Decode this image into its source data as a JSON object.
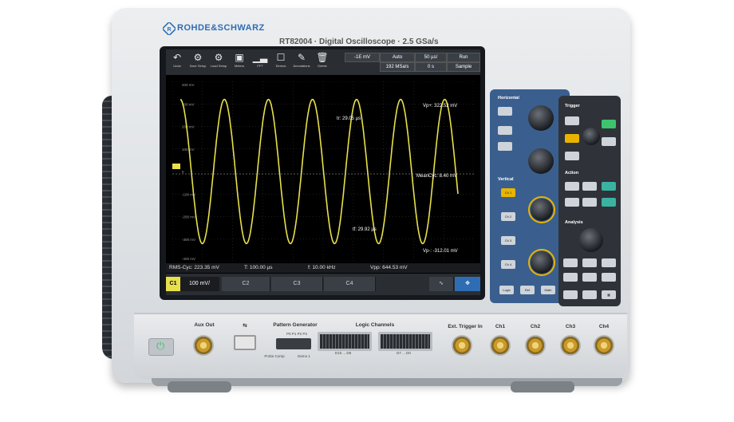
{
  "device": {
    "brand": "ROHDE&SCHWARZ",
    "model_line": "RT82004 · Digital Oscilloscope · 2.5 GSa/s",
    "accent_color": "#2e6db4",
    "trace_color": "#e8e04a"
  },
  "toolbar": {
    "items": [
      {
        "label": "Undo",
        "icon": "undo-icon"
      },
      {
        "label": "Save Setup",
        "icon": "save-icon"
      },
      {
        "label": "Load Setup",
        "icon": "load-icon"
      },
      {
        "label": "Meters",
        "icon": "meter-icon"
      },
      {
        "label": "FFT",
        "icon": "fft-icon"
      },
      {
        "label": "Demos",
        "icon": "demo-icon"
      },
      {
        "label": "Annotations",
        "icon": "annotation-icon"
      },
      {
        "label": "Delete",
        "icon": "delete-icon"
      }
    ]
  },
  "readout": {
    "trigger_level": "-1E mV",
    "mode": "Auto",
    "sample_rate": "192 MSa/s",
    "timebase": "50 µs/",
    "offset": "0 s",
    "run_state": "Run",
    "acq": "Sample"
  },
  "annotations": {
    "tr": "tr: 29.05 µs",
    "tf": "tf: 29.92 µs",
    "vp_pos": "Vp+: 322.52 mV",
    "mean_cyc": "MeanCyc: 8.40 mV",
    "vp_neg": "Vp-: -312.01 mV"
  },
  "measurements": {
    "rms": "RMS-Cyc: 223.35 mV",
    "period": "T: 100.00 µs",
    "freq": "f: 10.00 kHz",
    "vpp": "Vpp: 644.53 mV"
  },
  "channels": {
    "active": "C1",
    "active_scale": "100 mV/",
    "tabs": [
      "C2",
      "C3",
      "C4"
    ]
  },
  "panel": {
    "horizontal": "Horizontal",
    "trigger": "Trigger",
    "vertical": "Vertical",
    "action": "Action",
    "analysis": "Analysis",
    "buttons_vertical": [
      "Ch 1",
      "Ch 2",
      "Ch 3",
      "Ch 4"
    ],
    "bottom_buttons": [
      "Logic",
      "Ref",
      "Math"
    ]
  },
  "front": {
    "aux_out": "Aux Out",
    "pattern_gen": "Pattern Generator",
    "pattern_pins": "P0  P1  P2  P3",
    "probe_comp": "Probe Comp",
    "demo1": "Demo 1",
    "logic_channels": "Logic Channels",
    "logic_left": "D15 ... D8",
    "logic_right": "D7 ... D0",
    "ext_trigger": "Ext. Trigger In",
    "ch_labels": [
      "Ch1",
      "Ch2",
      "Ch3",
      "Ch4"
    ]
  },
  "waveform": {
    "cycles": 6.3,
    "amplitude_mv": 320,
    "y_range_mv": [
      -400,
      400
    ],
    "y_ticks": [
      "400 mV",
      "300 mV",
      "200 mV",
      "100 mV",
      "0",
      "-100 mV",
      "-200 mV",
      "-300 mV",
      "-400 mV"
    ]
  }
}
